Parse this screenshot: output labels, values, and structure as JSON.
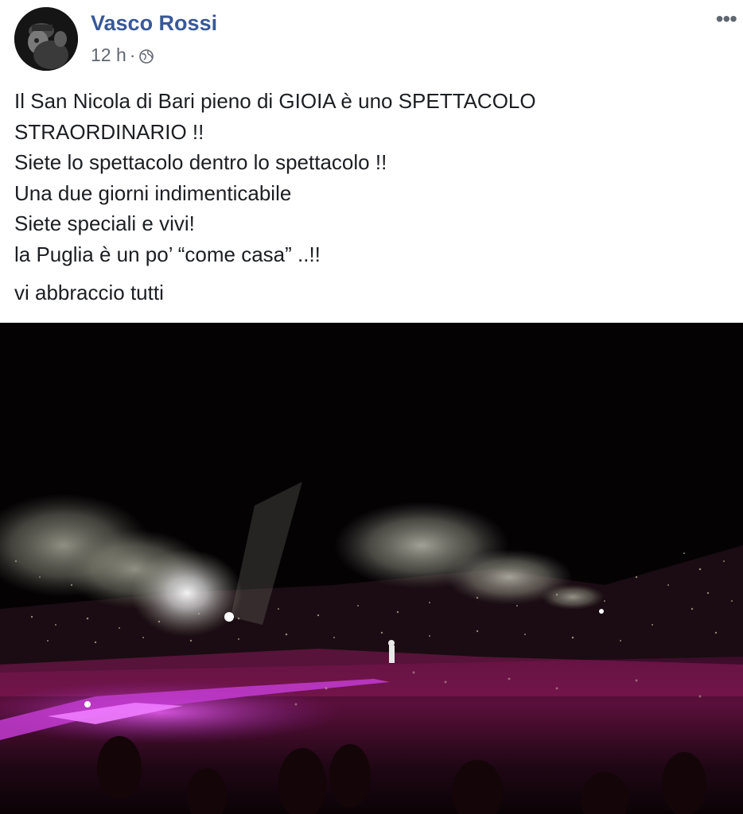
{
  "post": {
    "author": "Vasco Rossi",
    "time": "12 h",
    "separator": "·",
    "privacy_icon": "globe-icon",
    "more_icon": "more-options-icon",
    "more_label": "•••",
    "lines": [
      "Il San Nicola di Bari pieno di GIOIA è uno SPETTACOLO",
      "STRAORDINARIO !!",
      "Siete lo spettacolo dentro lo spettacolo !!",
      "Una due giorni indimenticabile",
      "Siete speciali e vivi!",
      "la Puglia è un po’ “come casa” ..!!",
      "vi abbraccio tutti"
    ]
  },
  "colors": {
    "author_link": "#385898",
    "meta_text": "#616770",
    "body_text": "#1c1e21",
    "stage_magenta": "#c23bd0"
  }
}
